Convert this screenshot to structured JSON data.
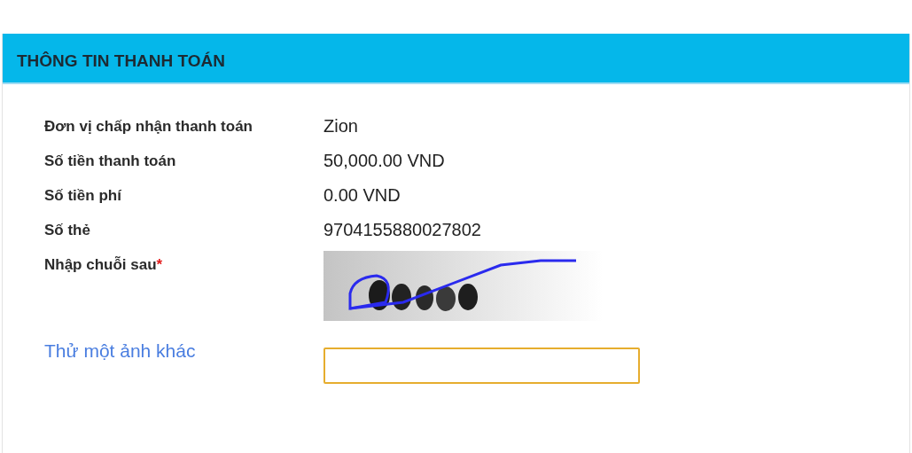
{
  "panel": {
    "title": "THÔNG TIN THANH TOÁN"
  },
  "fields": [
    {
      "label": "Đơn vị chấp nhận thanh toán",
      "value": "Zion"
    },
    {
      "label": "Số tiền thanh toán",
      "value": "50,000.00 VND"
    },
    {
      "label": "Số tiền phí",
      "value": "0.00 VND"
    },
    {
      "label": "Số thẻ",
      "value": "9704155880027802"
    }
  ],
  "captcha": {
    "label": "Nhập chuỗi sau",
    "required_mark": "*",
    "refresh_link": "Thử một ảnh khác"
  }
}
